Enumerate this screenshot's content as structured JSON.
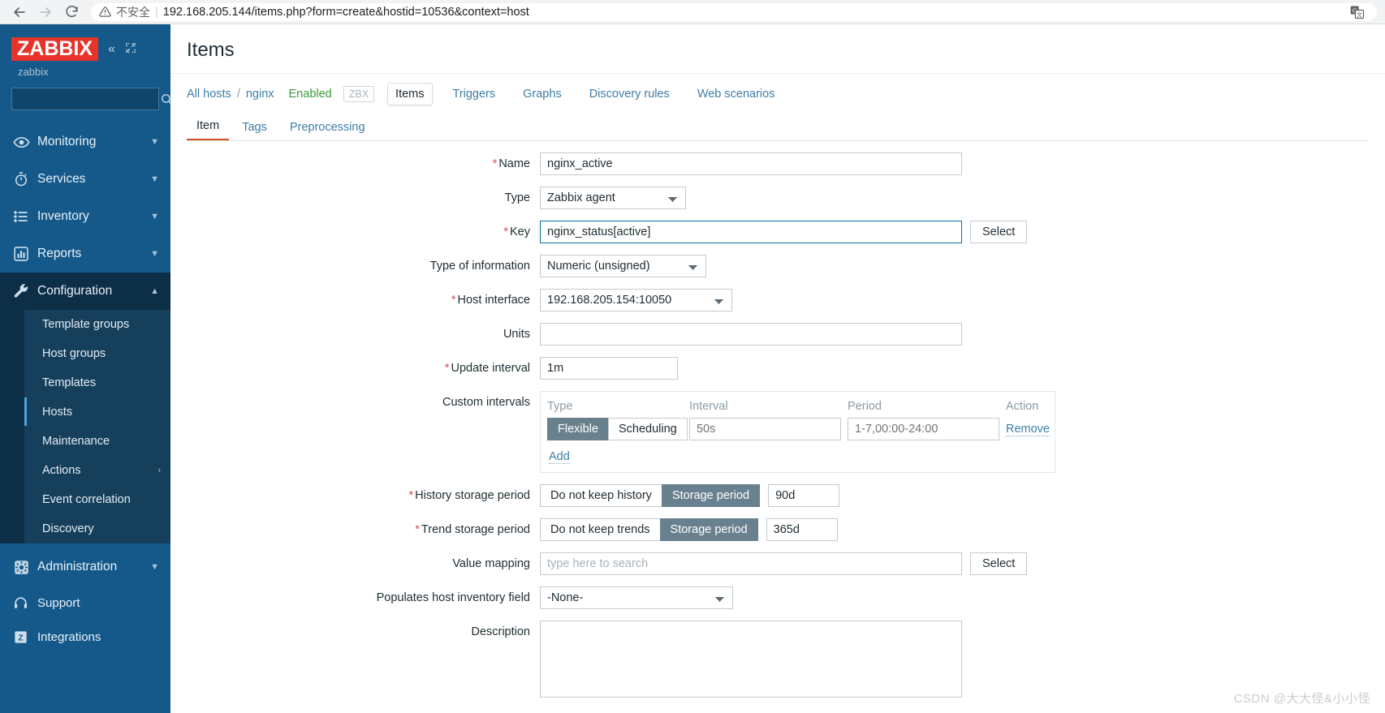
{
  "browser": {
    "back_icon": "back-arrow-icon",
    "forward_icon": "forward-arrow-icon",
    "reload_icon": "reload-icon",
    "warning_icon": "warning-triangle-icon",
    "security_label": "不安全",
    "url": "192.168.205.144/items.php?form=create&hostid=10536&context=host",
    "translate_icon": "translate-icon"
  },
  "sidebar": {
    "logo": "ZABBIX",
    "collapse_icon": "collapse-sidebar-icon",
    "hide_icon": "hide-sidebar-icon",
    "user": "zabbix",
    "search_placeholder": "",
    "search_value": "",
    "search_icon": "search-icon",
    "items": [
      {
        "label": "Monitoring",
        "icon": "eye-icon",
        "arrow": "chevron-down-icon",
        "active": false
      },
      {
        "label": "Services",
        "icon": "stopwatch-icon",
        "arrow": "chevron-down-icon",
        "active": false
      },
      {
        "label": "Inventory",
        "icon": "list-icon",
        "arrow": "chevron-down-icon",
        "active": false
      },
      {
        "label": "Reports",
        "icon": "bar-chart-icon",
        "arrow": "chevron-down-icon",
        "active": false
      },
      {
        "label": "Configuration",
        "icon": "wrench-icon",
        "arrow": "chevron-up-icon",
        "active": true
      }
    ],
    "submenu": [
      {
        "label": "Template groups",
        "current": false,
        "arrow": ""
      },
      {
        "label": "Host groups",
        "current": false,
        "arrow": ""
      },
      {
        "label": "Templates",
        "current": false,
        "arrow": ""
      },
      {
        "label": "Hosts",
        "current": true,
        "arrow": ""
      },
      {
        "label": "Maintenance",
        "current": false,
        "arrow": ""
      },
      {
        "label": "Actions",
        "current": false,
        "arrow": "›"
      },
      {
        "label": "Event correlation",
        "current": false,
        "arrow": ""
      },
      {
        "label": "Discovery",
        "current": false,
        "arrow": ""
      }
    ],
    "bottom_items": [
      {
        "label": "Administration",
        "icon": "gear-icon",
        "arrow": "chevron-down-icon"
      },
      {
        "label": "Support",
        "icon": "headset-icon",
        "arrow": ""
      },
      {
        "label": "Integrations",
        "icon": "zabbix-z-icon",
        "arrow": ""
      }
    ]
  },
  "page": {
    "title": "Items"
  },
  "breadcrumb": {
    "all_hosts": "All hosts",
    "separator": "/",
    "host": "nginx",
    "status": "Enabled",
    "badge": "ZBX",
    "tabs": [
      {
        "label": "Items",
        "selected": true
      },
      {
        "label": "Triggers",
        "selected": false
      },
      {
        "label": "Graphs",
        "selected": false
      },
      {
        "label": "Discovery rules",
        "selected": false
      },
      {
        "label": "Web scenarios",
        "selected": false
      }
    ]
  },
  "form_tabs": [
    {
      "label": "Item",
      "active": true
    },
    {
      "label": "Tags",
      "active": false
    },
    {
      "label": "Preprocessing",
      "active": false
    }
  ],
  "form": {
    "name": {
      "label": "Name",
      "required": true,
      "value": "nginx_active",
      "placeholder": ""
    },
    "type": {
      "label": "Type",
      "required": false,
      "value": "Zabbix agent"
    },
    "key": {
      "label": "Key",
      "required": true,
      "value": "nginx_status[active]",
      "select_button": "Select"
    },
    "type_of_information": {
      "label": "Type of information",
      "required": false,
      "value": "Numeric (unsigned)"
    },
    "host_interface": {
      "label": "Host interface",
      "required": true,
      "value": "192.168.205.154:10050"
    },
    "units": {
      "label": "Units",
      "required": false,
      "value": "",
      "placeholder": ""
    },
    "update_interval": {
      "label": "Update interval",
      "required": true,
      "value": "1m"
    },
    "custom_intervals": {
      "label": "Custom intervals",
      "columns": [
        "Type",
        "Interval",
        "Period",
        "Action"
      ],
      "rows": [
        {
          "type_options": [
            "Flexible",
            "Scheduling"
          ],
          "type_selected": "Flexible",
          "interval_value": "",
          "interval_placeholder": "50s",
          "period_value": "",
          "period_placeholder": "1-7,00:00-24:00",
          "action": "Remove"
        }
      ],
      "add_link": "Add"
    },
    "history_storage_period": {
      "label": "History storage period",
      "required": true,
      "options": [
        "Do not keep history",
        "Storage period"
      ],
      "selected": "Storage period",
      "value": "90d"
    },
    "trend_storage_period": {
      "label": "Trend storage period",
      "required": true,
      "options": [
        "Do not keep trends",
        "Storage period"
      ],
      "selected": "Storage period",
      "value": "365d"
    },
    "value_mapping": {
      "label": "Value mapping",
      "required": false,
      "value": "",
      "placeholder": "type here to search",
      "select_button": "Select"
    },
    "populates_host_inventory_field": {
      "label": "Populates host inventory field",
      "required": false,
      "value": "-None-"
    },
    "description": {
      "label": "Description",
      "required": false,
      "value": "",
      "placeholder": ""
    }
  },
  "watermark": "CSDN @大大怪&小小怪",
  "colors": {
    "sidebar_bg": "#14598a",
    "sidebar_active": "#0c2e47",
    "logo_red": "#e8332a",
    "accent_link": "#3d7ea6",
    "toggle_on": "#69818f",
    "tab_underline": "#d64f1e",
    "status_green": "#3a9b3a",
    "required_red": "#d75050"
  }
}
